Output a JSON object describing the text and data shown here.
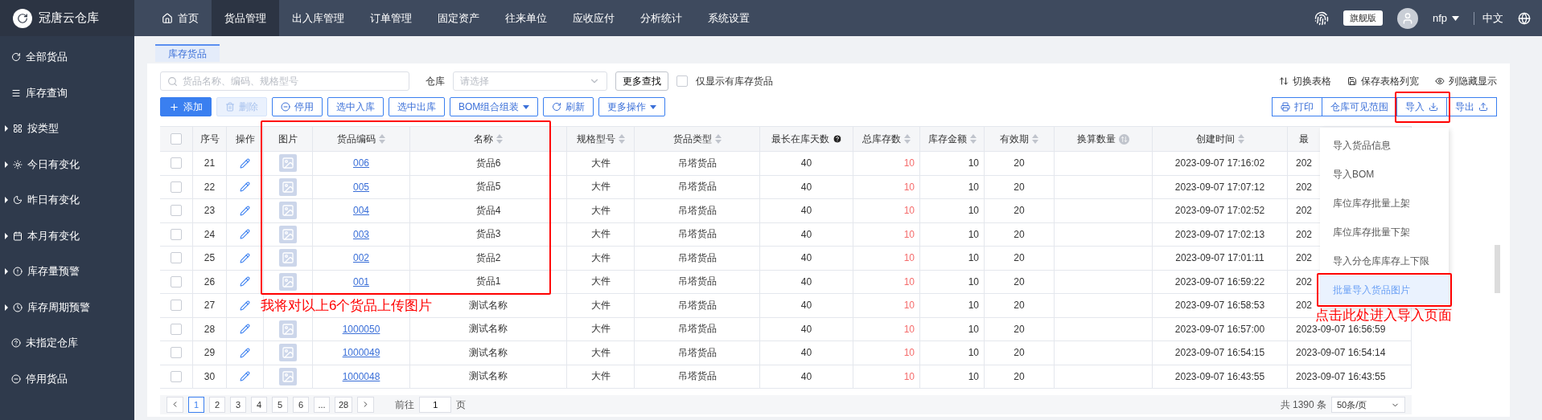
{
  "brand": {
    "name": "冠唐云仓库"
  },
  "nav": {
    "items": [
      {
        "label": "首页",
        "kind": "home",
        "selected": false
      },
      {
        "label": "货品管理",
        "kind": "plain",
        "selected": true
      },
      {
        "label": "出入库管理",
        "kind": "plain",
        "selected": false
      },
      {
        "label": "订单管理",
        "kind": "plain",
        "selected": false
      },
      {
        "label": "固定资产",
        "kind": "plain",
        "selected": false
      },
      {
        "label": "往来单位",
        "kind": "plain",
        "selected": false
      },
      {
        "label": "应收应付",
        "kind": "plain",
        "selected": false
      },
      {
        "label": "分析统计",
        "kind": "plain",
        "selected": false
      },
      {
        "label": "系统设置",
        "kind": "plain",
        "selected": false
      }
    ],
    "edition": "旗舰版",
    "user": "nfp",
    "language": "中文"
  },
  "sidebar": {
    "items": [
      {
        "label": "全部货品",
        "kind": "refresh",
        "expandable": false
      },
      {
        "label": "库存查询",
        "kind": "list",
        "expandable": false
      },
      {
        "label": "按类型",
        "kind": "grid",
        "expandable": true
      },
      {
        "label": "今日有变化",
        "kind": "sun",
        "expandable": true
      },
      {
        "label": "昨日有变化",
        "kind": "moon",
        "expandable": true
      },
      {
        "label": "本月有变化",
        "kind": "calendar",
        "expandable": true
      },
      {
        "label": "库存量预警",
        "kind": "alert",
        "expandable": true
      },
      {
        "label": "库存周期预警",
        "kind": "clock",
        "expandable": true
      },
      {
        "label": "未指定仓库",
        "kind": "help",
        "expandable": false
      },
      {
        "label": "停用货品",
        "kind": "minus",
        "expandable": false
      }
    ]
  },
  "page_tab": {
    "label": "库存货品",
    "selected": true
  },
  "filters": {
    "search_placeholder": "货品名称、编码、规格型号",
    "warehouse_label": "仓库",
    "warehouse_placeholder": "请选择",
    "more_search": "更多查找",
    "only_in_stock": {
      "label": "仅显示有库存货品",
      "checked": false
    }
  },
  "view_links": [
    {
      "label": "切换表格",
      "kind": "switch"
    },
    {
      "label": "保存表格列宽",
      "kind": "save"
    },
    {
      "label": "列隐藏显示",
      "kind": "eye"
    }
  ],
  "actions": [
    {
      "label": "添加",
      "kind": "primary"
    },
    {
      "label": "删除",
      "kind": "disabled"
    },
    {
      "label": "停用",
      "kind": "stop"
    },
    {
      "label": "选中入库",
      "kind": "plain"
    },
    {
      "label": "选中出库",
      "kind": "plain"
    },
    {
      "label": "BOM组合组装",
      "kind": "menu"
    },
    {
      "label": "刷新",
      "kind": "refresh"
    },
    {
      "label": "更多操作",
      "kind": "menu"
    }
  ],
  "right_actions": [
    {
      "label": "打印",
      "kind": "print"
    },
    {
      "label": "仓库可见范围",
      "kind": "plain"
    },
    {
      "label": "导入",
      "kind": "import"
    },
    {
      "label": "导出",
      "kind": "export"
    }
  ],
  "table": {
    "select_all": {
      "checked": false
    },
    "columns": [
      {
        "kind": "check"
      },
      {
        "label": "序号",
        "kind": "plain"
      },
      {
        "label": "操作",
        "kind": "plain"
      },
      {
        "label": "图片",
        "kind": "plain"
      },
      {
        "label": "货品编码",
        "kind": "sortable"
      },
      {
        "label": "名称",
        "kind": "sortable"
      },
      {
        "label": "规格型号",
        "kind": "sortable"
      },
      {
        "label": "货品类型",
        "kind": "sortable"
      },
      {
        "label": "最长在库天数",
        "kind": "help"
      },
      {
        "label": "总库存数",
        "kind": "sortable"
      },
      {
        "label": "库存金额",
        "kind": "sortable"
      },
      {
        "label": "有效期",
        "kind": "sortable"
      },
      {
        "label": "换算数量",
        "kind": "info"
      },
      {
        "label": "创建时间",
        "kind": "sortable"
      },
      {
        "label": "最",
        "kind": "plain"
      }
    ],
    "rows": [
      {
        "checked": false,
        "no": "21",
        "code": "006",
        "name": "货品6",
        "spec": "大件",
        "type": "吊塔货品",
        "days": "40",
        "total": "10",
        "amount": "10",
        "expiry": "20",
        "created": "2023-09-07 17:16:02",
        "column_15": "202"
      },
      {
        "checked": false,
        "no": "22",
        "code": "005",
        "name": "货品5",
        "spec": "大件",
        "type": "吊塔货品",
        "days": "40",
        "total": "10",
        "amount": "10",
        "expiry": "20",
        "created": "2023-09-07 17:07:12",
        "column_15": "202"
      },
      {
        "checked": false,
        "no": "23",
        "code": "004",
        "name": "货品4",
        "spec": "大件",
        "type": "吊塔货品",
        "days": "40",
        "total": "10",
        "amount": "10",
        "expiry": "20",
        "created": "2023-09-07 17:02:52",
        "column_15": "202"
      },
      {
        "checked": false,
        "no": "24",
        "code": "003",
        "name": "货品3",
        "spec": "大件",
        "type": "吊塔货品",
        "days": "40",
        "total": "10",
        "amount": "10",
        "expiry": "20",
        "created": "2023-09-07 17:02:13",
        "column_15": "202"
      },
      {
        "checked": false,
        "no": "25",
        "code": "002",
        "name": "货品2",
        "spec": "大件",
        "type": "吊塔货品",
        "days": "40",
        "total": "10",
        "amount": "10",
        "expiry": "20",
        "created": "2023-09-07 17:01:11",
        "column_15": "202"
      },
      {
        "checked": false,
        "no": "26",
        "code": "001",
        "name": "货品1",
        "spec": "大件",
        "type": "吊塔货品",
        "days": "40",
        "total": "10",
        "amount": "10",
        "expiry": "20",
        "created": "2023-09-07 16:59:22",
        "column_15": "202"
      },
      {
        "checked": false,
        "no": "27",
        "covered": true,
        "name": "测试名称",
        "spec": "大件",
        "type": "吊塔货品",
        "days": "40",
        "total": "10",
        "amount": "10",
        "expiry": "20",
        "created": "2023-09-07 16:58:53",
        "column_15": "202"
      },
      {
        "checked": false,
        "no": "28",
        "code": "1000050",
        "name": "测试名称",
        "spec": "大件",
        "type": "吊塔货品",
        "days": "40",
        "total": "10",
        "amount": "10",
        "expiry": "20",
        "created": "2023-09-07 16:57:00",
        "column_15": "2023-09-07 16:56:59"
      },
      {
        "checked": false,
        "no": "29",
        "code": "1000049",
        "name": "测试名称",
        "spec": "大件",
        "type": "吊塔货品",
        "days": "40",
        "total": "10",
        "amount": "10",
        "expiry": "20",
        "created": "2023-09-07 16:54:15",
        "column_15": "2023-09-07 16:54:14"
      },
      {
        "checked": false,
        "no": "30",
        "code": "1000048",
        "name": "测试名称",
        "spec": "大件",
        "type": "吊塔货品",
        "days": "40",
        "total": "10",
        "amount": "10",
        "expiry": "20",
        "created": "2023-09-07 16:43:55",
        "column_15": "2023-09-07 16:43:55"
      }
    ]
  },
  "import_menu": [
    {
      "label": "导入货品信息",
      "selected": false
    },
    {
      "label": "导入BOM",
      "selected": false
    },
    {
      "label": "库位库存批量上架",
      "selected": false
    },
    {
      "label": "库位库存批量下架",
      "selected": false
    },
    {
      "label": "导入分仓库库存上下限",
      "selected": false
    },
    {
      "label": "批量导入货品图片",
      "selected": true
    }
  ],
  "pagination": {
    "pages": [
      {
        "label": "1",
        "selected": true
      },
      {
        "label": "2",
        "selected": false
      },
      {
        "label": "3",
        "selected": false
      },
      {
        "label": "4",
        "selected": false
      },
      {
        "label": "5",
        "selected": false
      },
      {
        "label": "6",
        "selected": false
      },
      {
        "label": "...",
        "selected": false
      },
      {
        "label": "28",
        "selected": false
      }
    ],
    "goto_label": "前往",
    "goto_value": "1",
    "goto_suffix": "页",
    "total": "共 1390 条",
    "page_size": "50条/页"
  },
  "annotations": [
    {
      "kind": "table_box"
    },
    {
      "kind": "table_note",
      "text": "我将对以上6个货品上传图片"
    },
    {
      "kind": "import_box"
    },
    {
      "kind": "menu_box"
    },
    {
      "kind": "menu_note",
      "text": "点击此处进入导入页面"
    }
  ]
}
